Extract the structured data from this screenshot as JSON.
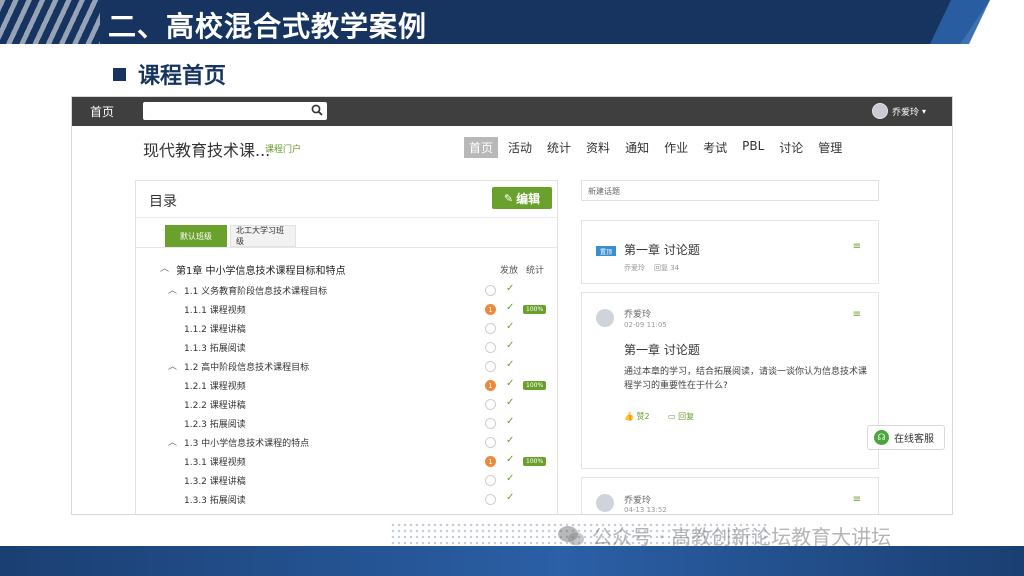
{
  "slide": {
    "title": "二、高校混合式教学案例",
    "section": "课程首页"
  },
  "app": {
    "topbar": {
      "home": "首页",
      "user_name": "乔爱玲",
      "caret": "▾"
    },
    "course": {
      "title": "现代教育技术课...",
      "subtitle": "课程门户"
    },
    "nav": [
      {
        "label": "首页",
        "active": true
      },
      {
        "label": "活动"
      },
      {
        "label": "统计"
      },
      {
        "label": "资料"
      },
      {
        "label": "通知"
      },
      {
        "label": "作业"
      },
      {
        "label": "考试"
      },
      {
        "label": "PBL"
      },
      {
        "label": "讨论"
      },
      {
        "label": "管理"
      }
    ],
    "toc": {
      "heading": "目录",
      "edit_label": "编辑",
      "tabs": [
        "默认班级",
        "北工大学习班级"
      ],
      "col_release": "发放",
      "col_stats": "统计",
      "chapter": "第1章 中小学信息技术课程目标和特点",
      "sections": [
        {
          "title": "1.1  义务教育阶段信息技术课程目标",
          "items": [
            {
              "label": "1.1.1 课程视频",
              "badge": "1",
              "pct": "100%"
            },
            {
              "label": "1.1.2 课程讲稿"
            },
            {
              "label": "1.1.3 拓展阅读"
            }
          ]
        },
        {
          "title": "1.2  高中阶段信息技术课程目标",
          "items": [
            {
              "label": "1.2.1 课程视频",
              "badge": "1",
              "pct": "100%"
            },
            {
              "label": "1.2.2 课程讲稿"
            },
            {
              "label": "1.2.3 拓展阅读"
            }
          ]
        },
        {
          "title": "1.3  中小学信息技术课程的特点",
          "items": [
            {
              "label": "1.3.1 课程视频",
              "badge": "1",
              "pct": "100%"
            },
            {
              "label": "1.3.2 课程讲稿"
            },
            {
              "label": "1.3.3 拓展阅读"
            }
          ]
        }
      ]
    },
    "discussion": {
      "new_topic_placeholder": "新建话题",
      "card1": {
        "tag": "置顶",
        "title": "第一章 讨论题",
        "author": "乔爱玲",
        "replies": "回复 34"
      },
      "card2": {
        "author": "乔爱玲",
        "time": "02-09 11:05",
        "title": "第一章 讨论题",
        "body": "通过本章的学习，结合拓展阅读，请谈一谈你认为信息技术课程学习的重要性在于什么?",
        "like": "赞2",
        "reply": "回复"
      },
      "card3": {
        "author": "乔爱玲",
        "time": "04-13 13:52"
      }
    },
    "service": {
      "label": "在线客服"
    }
  },
  "watermark": {
    "text": "公众号 · 高教创新论坛教育大讲坛"
  },
  "icons": {
    "search": "search-icon",
    "menu": "menu-icon",
    "pencil": "pencil-icon",
    "headset": "headset-icon",
    "wechat": "wechat-icon"
  },
  "colors": {
    "banner": "#16345f",
    "topbar": "#3f3f3f",
    "accent_green": "#6aa02c",
    "badge_orange": "#f0883a",
    "tag_blue": "#3a8ed0"
  }
}
